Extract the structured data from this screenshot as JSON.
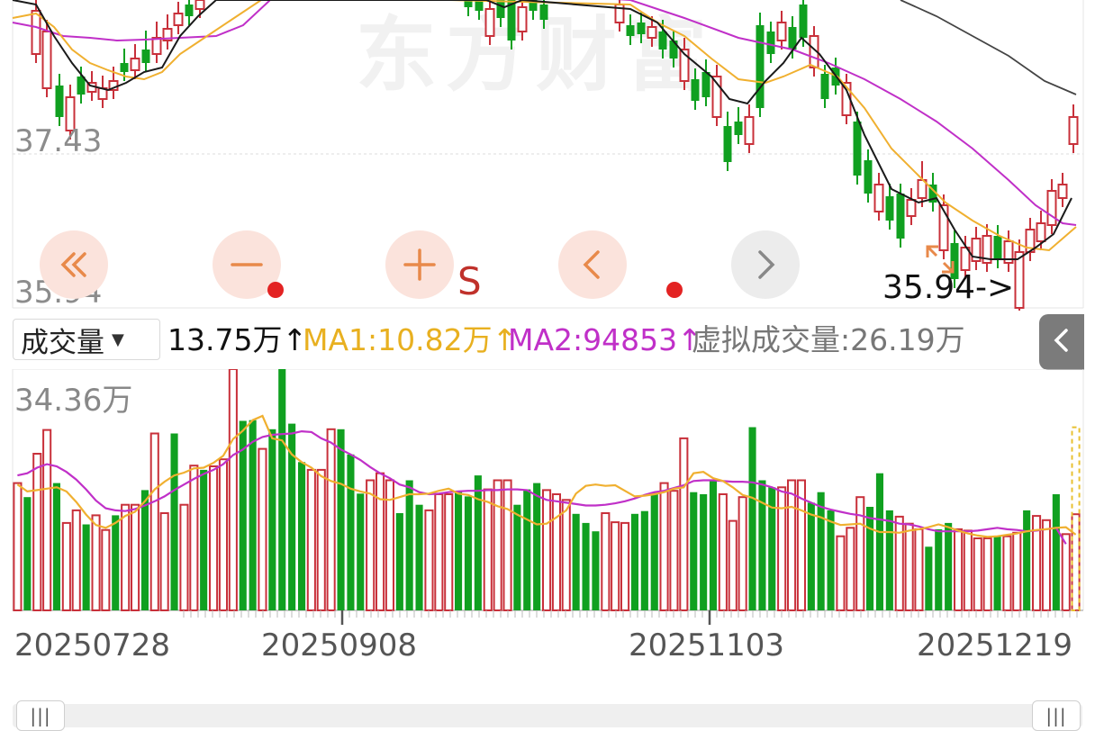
{
  "watermark": "东方财富",
  "price_axis": {
    "upper_label": "37.43",
    "lower_label": "35.94"
  },
  "low_marker": "35.94->",
  "controls": {
    "rewind": "«",
    "zoom_out": "−",
    "zoom_in": "+",
    "s_label": "S",
    "prev": "‹",
    "next": "›"
  },
  "indicator": {
    "selected": "成交量",
    "volume": "13.75万↑",
    "ma1": "MA1:10.82万↑",
    "ma2": "MA2:94853↑",
    "virtual": "虚拟成交量:26.19万"
  },
  "volume_axis": {
    "max_label": "34.36万"
  },
  "dates": [
    "20250728",
    "20250908",
    "20251103",
    "20251219"
  ],
  "colors": {
    "up": "#c8303a",
    "down": "#10a020",
    "ma5": "#1a1a1a",
    "ma10": "#f0b030",
    "ma20": "#c030c8",
    "ma60": "#444444",
    "dashed": "#e8c030",
    "accent_dot": "#e32323"
  },
  "chart_data": {
    "type": "bar",
    "title": "",
    "y_reference_prices": [
      37.43,
      35.94
    ],
    "volume_max": "34.36万",
    "x_ticks": [
      "20250728",
      "20250908",
      "20251103",
      "20251219"
    ],
    "series": [
      {
        "name": "成交量",
        "values": [
          18.2,
          16.2,
          22.4,
          25.8,
          18.2,
          12.5,
          14.3,
          12.3,
          13.6,
          11.5,
          13.6,
          15.1,
          15.1,
          17.2,
          25.3,
          13.9,
          25.3,
          15.1,
          20.7,
          20.1,
          20.6,
          21.6,
          34.5,
          27.1,
          27.2,
          23.1,
          25.9,
          34.5,
          26.7,
          21.2,
          20.1,
          20.1,
          25.9,
          25.9,
          22.3,
          16.7,
          18.6,
          19.6,
          18.6,
          13.9,
          18.6,
          15.1,
          14.3,
          16.6,
          16.6,
          17.1,
          16.3,
          19.3,
          17.3,
          18.6,
          18.6,
          15.1,
          17.3,
          18.2,
          17.2,
          16.6,
          15.8,
          13.8,
          12.5,
          11.3,
          13.9,
          12.6,
          12.5,
          13.8,
          14.2,
          16.9,
          18.2,
          17.1,
          24.6,
          16.9,
          16.6,
          18.7,
          16.6,
          12.8,
          16.2,
          26.2,
          18.6,
          17.6,
          17.6,
          18.6,
          18.6,
          15.4,
          16.9,
          14.3,
          10.6,
          11.8,
          16.2,
          14.8,
          19.6,
          14.3,
          13.4,
          12.4,
          11.6,
          9.1,
          11.6,
          12.5,
          11.6,
          11.4,
          10.3,
          10.3,
          10.6,
          10.6,
          11.1,
          14.3,
          13.5,
          12.9,
          16.6,
          10.9,
          13.75
        ]
      },
      {
        "name": "MA1",
        "values": [
          18,
          17,
          17.2,
          17.4,
          17.6,
          17,
          15.5,
          13.7,
          12.2,
          11.8,
          12.5,
          13.5,
          14.1,
          15.6,
          17.3,
          18.4,
          19.3,
          19.7,
          20.3,
          20.4,
          21.1,
          22.1,
          24.5,
          25.7,
          27.2,
          27.8,
          24.6,
          24.3,
          22.3,
          21.2,
          20.4,
          19.2,
          18.5,
          18.1,
          17.4,
          17,
          16.7,
          15.9,
          15.8,
          16.2,
          16.6,
          16.6,
          16.7,
          17.1,
          17.4,
          16.7,
          16.5,
          15.9,
          15.5,
          14.9,
          14.5,
          13.7,
          13,
          12.3,
          12.4,
          13.3,
          14.3,
          16.7,
          17.8,
          18,
          17.8,
          17.9,
          17.1,
          16.3,
          16.4,
          16.6,
          16.9,
          17.4,
          17.6,
          19.6,
          19.8,
          18.9,
          18.5,
          17.6,
          16.5,
          16.1,
          15.4,
          14.7,
          14.6,
          14.8,
          14.3,
          13.7,
          13.3,
          12.7,
          12.2,
          12.3,
          12.4,
          11.7,
          11.2,
          11.2,
          11.1,
          11.4,
          11.6,
          11.9,
          12.3,
          11.9,
          11.4,
          11.0,
          10.7,
          10.5,
          10.6,
          10.8,
          11.0,
          11.3,
          11.5,
          11.6,
          11.8,
          11.9,
          10.82
        ]
      },
      {
        "name": "MA2",
        "values": [
          19.3,
          19.6,
          20.4,
          20.9,
          20.6,
          19.8,
          18.7,
          17.3,
          15.7,
          14.6,
          14.3,
          14.2,
          14.5,
          15,
          15.6,
          16.3,
          17.2,
          18,
          18.8,
          19.5,
          20.1,
          20.9,
          22.2,
          23,
          24.1,
          24.8,
          25.1,
          25.2,
          25.3,
          25.6,
          25.5,
          24.6,
          24,
          23,
          22.3,
          21.5,
          20.5,
          19.6,
          18.9,
          18,
          17.6,
          16.9,
          16.6,
          16.7,
          16.9,
          17,
          17.1,
          17.1,
          17.2,
          17.2,
          17.3,
          17.3,
          17.2,
          16.4,
          15.8,
          15.6,
          15.4,
          15.2,
          15,
          15,
          15.1,
          15.3,
          15.6,
          16,
          16.5,
          16.9,
          17.1,
          17.5,
          17.9,
          18.5,
          18.6,
          18.6,
          18.5,
          18.4,
          18.4,
          18.3,
          18,
          17.6,
          17,
          16.7,
          16,
          15.4,
          14.8,
          14.4,
          14.1,
          13.8,
          13.6,
          13.2,
          13,
          12.8,
          12.4,
          12.3,
          12.0,
          11.6,
          11.3,
          11.3,
          11.3,
          11.3,
          11.4,
          11.6,
          11.8,
          11.6,
          11.5,
          11.3,
          11.4,
          11.6,
          11.8,
          9.49
        ]
      }
    ]
  }
}
